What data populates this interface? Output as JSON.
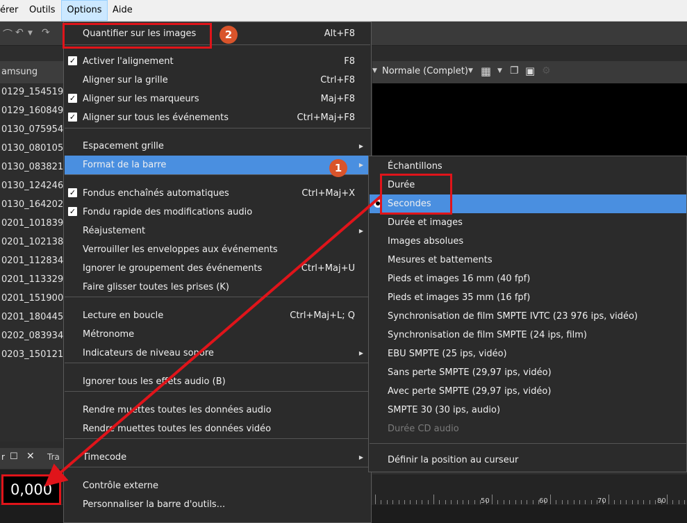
{
  "menubar": {
    "items": [
      "érer",
      "Outils",
      "Options",
      "Aide"
    ]
  },
  "left_panel": {
    "header": "amsung",
    "files": [
      "0129_154519.",
      "0129_160849.",
      "0130_075954.",
      "0130_080105.",
      "0130_083821.",
      "0130_124246.",
      "0130_164202.",
      "0201_101839.",
      "0201_102138.",
      "0201_112834.",
      "0201_113329.",
      "0201_151900.",
      "0201_180445.",
      "0202_083934.",
      "0203_150121."
    ],
    "tab_label": "Tra",
    "timecode": "0,000"
  },
  "preview_toolbar": {
    "quality": "Normale (Complet)"
  },
  "ruler": {
    "labels": [
      "50",
      "60",
      "70",
      "80"
    ]
  },
  "options_menu": {
    "items": [
      {
        "label": "Quantifier sur les images",
        "shortcut": "Alt+F8",
        "checked": false,
        "submenu": false
      },
      {
        "label": "Activer l'alignement",
        "shortcut": "F8",
        "checked": true,
        "submenu": false
      },
      {
        "label": "Aligner sur la grille",
        "shortcut": "Ctrl+F8",
        "checked": false,
        "submenu": false
      },
      {
        "label": "Aligner sur les marqueurs",
        "shortcut": "Maj+F8",
        "checked": true,
        "submenu": false
      },
      {
        "label": "Aligner sur tous les événements",
        "shortcut": "Ctrl+Maj+F8",
        "checked": true,
        "submenu": false
      },
      {
        "label": "Espacement grille",
        "shortcut": "",
        "checked": false,
        "submenu": true
      },
      {
        "label": "Format de la barre",
        "shortcut": "",
        "checked": false,
        "submenu": true
      },
      {
        "label": "Fondus enchaînés automatiques",
        "shortcut": "Ctrl+Maj+X",
        "checked": true,
        "submenu": false
      },
      {
        "label": "Fondu rapide des modifications audio",
        "shortcut": "",
        "checked": true,
        "submenu": false
      },
      {
        "label": "Réajustement",
        "shortcut": "",
        "checked": false,
        "submenu": true
      },
      {
        "label": "Verrouiller les enveloppes aux événements",
        "shortcut": "",
        "checked": false,
        "submenu": false
      },
      {
        "label": "Ignorer le groupement des événements",
        "shortcut": "Ctrl+Maj+U",
        "checked": false,
        "submenu": false
      },
      {
        "label": "Faire glisser toutes les prises (K)",
        "shortcut": "",
        "checked": false,
        "submenu": false
      },
      {
        "label": "Lecture en boucle",
        "shortcut": "Ctrl+Maj+L; Q",
        "checked": false,
        "submenu": false
      },
      {
        "label": "Métronome",
        "shortcut": "",
        "checked": false,
        "submenu": false
      },
      {
        "label": "Indicateurs de niveau sonore",
        "shortcut": "",
        "checked": false,
        "submenu": true
      },
      {
        "label": "Ignorer tous les effets audio (B)",
        "shortcut": "",
        "checked": false,
        "submenu": false
      },
      {
        "label": "Rendre muettes toutes les données audio",
        "shortcut": "",
        "checked": false,
        "submenu": false
      },
      {
        "label": "Rendre muettes toutes les données vidéo",
        "shortcut": "",
        "checked": false,
        "submenu": false
      },
      {
        "label": "Timecode",
        "shortcut": "",
        "checked": false,
        "submenu": true
      },
      {
        "label": "Contrôle externe",
        "shortcut": "",
        "checked": false,
        "submenu": false
      },
      {
        "label": "Personnaliser la barre d'outils...",
        "shortcut": "",
        "checked": false,
        "submenu": false
      }
    ]
  },
  "format_submenu": {
    "items": [
      {
        "label": "Échantillons",
        "selected": false,
        "disabled": false
      },
      {
        "label": "Durée",
        "selected": false,
        "disabled": false
      },
      {
        "label": "Secondes",
        "selected": true,
        "disabled": false
      },
      {
        "label": "Durée et images",
        "selected": false,
        "disabled": false
      },
      {
        "label": "Images absolues",
        "selected": false,
        "disabled": false
      },
      {
        "label": "Mesures et battements",
        "selected": false,
        "disabled": false
      },
      {
        "label": "Pieds et images 16 mm (40 fpf)",
        "selected": false,
        "disabled": false
      },
      {
        "label": "Pieds et images 35 mm (16 fpf)",
        "selected": false,
        "disabled": false
      },
      {
        "label": "Synchronisation de film SMPTE IVTC (23 976 ips, vidéo)",
        "selected": false,
        "disabled": false
      },
      {
        "label": "Synchronisation de film SMPTE (24 ips, film)",
        "selected": false,
        "disabled": false
      },
      {
        "label": "EBU SMPTE (25 ips, vidéo)",
        "selected": false,
        "disabled": false
      },
      {
        "label": "Sans perte SMPTE (29,97 ips, vidéo)",
        "selected": false,
        "disabled": false
      },
      {
        "label": "Avec perte SMPTE (29,97 ips, vidéo)",
        "selected": false,
        "disabled": false
      },
      {
        "label": "SMPTE 30 (30 ips, audio)",
        "selected": false,
        "disabled": false
      },
      {
        "label": "Durée CD audio",
        "selected": false,
        "disabled": true
      },
      {
        "label": "Définir la position au curseur",
        "selected": false,
        "disabled": false
      }
    ]
  },
  "annotations": {
    "badge_1": "1",
    "badge_2": "2",
    "accent_color": "#e0141a",
    "highlight_color": "#4a8fe0"
  }
}
